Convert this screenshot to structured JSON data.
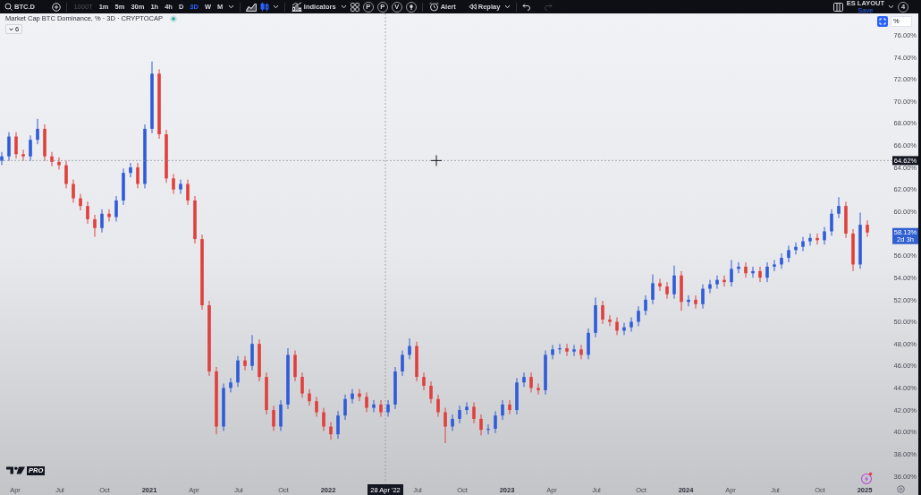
{
  "toolbar": {
    "symbol": "BTC.D",
    "intervals": [
      {
        "label": "1000T",
        "selected": false,
        "disabled": true
      },
      {
        "label": "1m",
        "selected": false,
        "disabled": false
      },
      {
        "label": "5m",
        "selected": false,
        "disabled": false
      },
      {
        "label": "30m",
        "selected": false,
        "disabled": false
      },
      {
        "label": "1h",
        "selected": false,
        "disabled": false
      },
      {
        "label": "4h",
        "selected": false,
        "disabled": false
      },
      {
        "label": "D",
        "selected": false,
        "disabled": false
      },
      {
        "label": "3D",
        "selected": true,
        "disabled": false
      },
      {
        "label": "W",
        "selected": false,
        "disabled": false
      },
      {
        "label": "M",
        "selected": false,
        "disabled": false
      }
    ],
    "chart_types": [
      {
        "kind": "area",
        "selected": false
      },
      {
        "kind": "candles",
        "selected": true
      }
    ],
    "indicators": "Indicators",
    "quick_buttons": [
      {
        "kind": "letter",
        "label": "P"
      },
      {
        "kind": "letter",
        "label": "P"
      },
      {
        "kind": "letter",
        "label": "V"
      },
      {
        "kind": "bulb"
      }
    ],
    "alert": "Alert",
    "replay": "Replay",
    "undo": {
      "disabled": false
    },
    "redo": {
      "disabled": true
    },
    "layout": {
      "name": "ES LAYOUT",
      "action": "Save"
    },
    "notifications": "4"
  },
  "chart": {
    "legend": {
      "title": "Market Cap BTC Dominance, % · 3D · CRYPTOCAP",
      "indicator_count": "6"
    },
    "scale_controls": {
      "auto_scale": {
        "on": true
      },
      "mode": "%"
    },
    "logo": {
      "badge": "PRO"
    },
    "last_price": {
      "price": "58.13%",
      "countdown": "2d 3h"
    },
    "chart_data": {
      "type": "candlestick",
      "x": [
        2020.175,
        2020.215,
        2020.255,
        2020.295,
        2020.335,
        2020.375,
        2020.415,
        2020.455,
        2020.495,
        2020.535,
        2020.575,
        2020.615,
        2020.655,
        2020.695,
        2020.735,
        2020.775,
        2020.815,
        2020.855,
        2020.895,
        2020.935,
        2020.975,
        2021.015,
        2021.055,
        2021.095,
        2021.135,
        2021.175,
        2021.215,
        2021.255,
        2021.295,
        2021.335,
        2021.375,
        2021.415,
        2021.455,
        2021.495,
        2021.535,
        2021.575,
        2021.615,
        2021.655,
        2021.695,
        2021.735,
        2021.775,
        2021.815,
        2021.855,
        2021.895,
        2021.935,
        2021.975,
        2022.015,
        2022.055,
        2022.095,
        2022.135,
        2022.175,
        2022.215,
        2022.255,
        2022.295,
        2022.335,
        2022.375,
        2022.415,
        2022.455,
        2022.495,
        2022.535,
        2022.575,
        2022.615,
        2022.655,
        2022.695,
        2022.735,
        2022.775,
        2022.815,
        2022.855,
        2022.895,
        2022.935,
        2022.975,
        2023.015,
        2023.055,
        2023.095,
        2023.135,
        2023.175,
        2023.215,
        2023.255,
        2023.295,
        2023.335,
        2023.375,
        2023.415,
        2023.455,
        2023.495,
        2023.535,
        2023.575,
        2023.615,
        2023.655,
        2023.695,
        2023.735,
        2023.775,
        2023.815,
        2023.855,
        2023.895,
        2023.935,
        2023.975,
        2024.015,
        2024.055,
        2024.095,
        2024.135,
        2024.175,
        2024.215,
        2024.255,
        2024.295,
        2024.335,
        2024.375,
        2024.415,
        2024.455,
        2024.495,
        2024.535,
        2024.575,
        2024.615,
        2024.655,
        2024.695,
        2024.735,
        2024.775,
        2024.815,
        2024.855,
        2024.895,
        2024.935,
        2024.975,
        2025.015
      ],
      "ohlc": [
        [
          64.6,
          65.4,
          64.2,
          65.0
        ],
        [
          65.0,
          67.2,
          64.6,
          66.8
        ],
        [
          66.8,
          67.2,
          64.8,
          65.2
        ],
        [
          65.2,
          65.6,
          64.6,
          65.0
        ],
        [
          65.0,
          66.9,
          64.6,
          66.5
        ],
        [
          66.5,
          68.4,
          66.1,
          67.5
        ],
        [
          67.5,
          67.9,
          64.6,
          65.0
        ],
        [
          65.0,
          65.4,
          64.1,
          64.5
        ],
        [
          64.5,
          64.9,
          63.8,
          64.2
        ],
        [
          64.2,
          64.6,
          62.1,
          62.5
        ],
        [
          62.5,
          62.9,
          60.8,
          61.2
        ],
        [
          61.2,
          61.6,
          60.1,
          60.5
        ],
        [
          60.5,
          60.9,
          58.9,
          59.3
        ],
        [
          59.3,
          59.7,
          57.7,
          58.5
        ],
        [
          58.5,
          60.2,
          58.1,
          59.8
        ],
        [
          59.8,
          60.2,
          59.1,
          59.5
        ],
        [
          59.5,
          61.4,
          59.1,
          61.0
        ],
        [
          61.0,
          63.9,
          60.6,
          63.5
        ],
        [
          63.5,
          64.4,
          63.1,
          64.0
        ],
        [
          64.0,
          64.4,
          62.1,
          62.5
        ],
        [
          62.5,
          67.9,
          62.1,
          67.5
        ],
        [
          67.5,
          73.6,
          67.1,
          72.5
        ],
        [
          72.5,
          72.9,
          66.6,
          67.0
        ],
        [
          67.0,
          67.4,
          62.6,
          63.0
        ],
        [
          63.0,
          63.4,
          61.6,
          62.0
        ],
        [
          62.0,
          62.9,
          61.6,
          62.5
        ],
        [
          62.5,
          62.9,
          60.6,
          61.0
        ],
        [
          61.0,
          61.4,
          57.1,
          57.5
        ],
        [
          57.5,
          57.9,
          51.1,
          51.5
        ],
        [
          51.5,
          51.9,
          45.1,
          45.5
        ],
        [
          45.5,
          45.9,
          39.8,
          40.5
        ],
        [
          40.5,
          44.4,
          40.1,
          44.0
        ],
        [
          44.0,
          44.9,
          43.6,
          44.5
        ],
        [
          44.5,
          46.9,
          44.1,
          46.5
        ],
        [
          46.5,
          46.9,
          45.6,
          46.0
        ],
        [
          46.0,
          48.8,
          45.6,
          48.0
        ],
        [
          48.0,
          48.4,
          44.6,
          45.0
        ],
        [
          45.0,
          45.4,
          41.6,
          42.0
        ],
        [
          42.0,
          42.4,
          40.1,
          40.5
        ],
        [
          40.5,
          42.9,
          40.1,
          42.5
        ],
        [
          42.5,
          47.6,
          42.1,
          47.0
        ],
        [
          47.0,
          47.4,
          44.6,
          45.0
        ],
        [
          45.0,
          45.4,
          43.1,
          43.5
        ],
        [
          43.5,
          43.9,
          42.4,
          42.8
        ],
        [
          42.8,
          43.2,
          41.4,
          41.8
        ],
        [
          41.8,
          42.2,
          40.1,
          40.5
        ],
        [
          40.5,
          40.9,
          39.3,
          39.8
        ],
        [
          39.8,
          41.9,
          39.4,
          41.5
        ],
        [
          41.5,
          43.4,
          41.1,
          43.0
        ],
        [
          43.0,
          43.9,
          42.6,
          43.5
        ],
        [
          43.5,
          43.9,
          42.8,
          43.2
        ],
        [
          43.2,
          43.6,
          41.8,
          42.2
        ],
        [
          42.2,
          42.9,
          41.8,
          42.5
        ],
        [
          42.5,
          42.9,
          41.4,
          41.8
        ],
        [
          41.8,
          42.9,
          41.4,
          42.5
        ],
        [
          42.5,
          45.9,
          42.1,
          45.5
        ],
        [
          45.5,
          47.4,
          45.1,
          47.0
        ],
        [
          47.0,
          48.5,
          46.6,
          47.8
        ],
        [
          47.8,
          48.2,
          44.6,
          45.0
        ],
        [
          45.0,
          45.4,
          43.8,
          44.2
        ],
        [
          44.2,
          44.6,
          42.6,
          43.0
        ],
        [
          43.0,
          43.4,
          41.4,
          41.8
        ],
        [
          41.8,
          42.2,
          39.0,
          40.5
        ],
        [
          40.5,
          41.6,
          40.1,
          41.2
        ],
        [
          41.2,
          42.4,
          40.8,
          42.0
        ],
        [
          42.0,
          42.7,
          41.6,
          42.3
        ],
        [
          42.3,
          42.7,
          40.8,
          41.2
        ],
        [
          41.2,
          41.6,
          39.7,
          40.2
        ],
        [
          40.2,
          40.7,
          39.8,
          40.3
        ],
        [
          40.3,
          41.9,
          39.9,
          41.5
        ],
        [
          41.5,
          42.9,
          41.1,
          42.5
        ],
        [
          42.5,
          42.9,
          41.6,
          42.0
        ],
        [
          42.0,
          44.9,
          41.6,
          44.5
        ],
        [
          44.5,
          45.4,
          44.1,
          45.0
        ],
        [
          45.0,
          45.4,
          43.6,
          44.0
        ],
        [
          44.0,
          44.4,
          43.4,
          43.8
        ],
        [
          43.8,
          47.4,
          43.4,
          47.0
        ],
        [
          47.0,
          47.9,
          46.6,
          47.5
        ],
        [
          47.5,
          48.0,
          47.1,
          47.6
        ],
        [
          47.6,
          48.0,
          46.9,
          47.3
        ],
        [
          47.3,
          47.9,
          46.9,
          47.5
        ],
        [
          47.5,
          47.9,
          46.6,
          47.0
        ],
        [
          47.0,
          49.4,
          46.6,
          49.0
        ],
        [
          49.0,
          52.2,
          48.6,
          51.5
        ],
        [
          51.5,
          51.9,
          49.8,
          50.2
        ],
        [
          50.2,
          50.6,
          49.6,
          50.0
        ],
        [
          50.0,
          50.4,
          48.8,
          49.2
        ],
        [
          49.2,
          49.9,
          48.8,
          49.5
        ],
        [
          49.5,
          50.4,
          49.1,
          50.0
        ],
        [
          50.0,
          51.4,
          49.6,
          51.0
        ],
        [
          51.0,
          52.4,
          50.6,
          52.0
        ],
        [
          52.0,
          54.3,
          51.6,
          53.5
        ],
        [
          53.5,
          53.9,
          52.8,
          53.2
        ],
        [
          53.2,
          53.6,
          52.1,
          52.5
        ],
        [
          52.5,
          55.1,
          52.1,
          54.2
        ],
        [
          54.2,
          54.6,
          51.0,
          51.8
        ],
        [
          51.8,
          52.4,
          51.4,
          52.0
        ],
        [
          52.0,
          52.4,
          51.2,
          51.6
        ],
        [
          51.6,
          53.4,
          51.2,
          53.0
        ],
        [
          53.0,
          53.8,
          52.6,
          53.4
        ],
        [
          53.4,
          54.2,
          53.0,
          53.8
        ],
        [
          53.8,
          54.2,
          53.2,
          53.6
        ],
        [
          53.6,
          55.6,
          53.2,
          54.8
        ],
        [
          54.8,
          55.4,
          54.4,
          55.0
        ],
        [
          55.0,
          55.4,
          54.0,
          54.4
        ],
        [
          54.4,
          55.0,
          54.0,
          54.6
        ],
        [
          54.6,
          55.0,
          53.6,
          54.0
        ],
        [
          54.0,
          55.4,
          53.6,
          55.0
        ],
        [
          55.0,
          55.6,
          54.6,
          55.2
        ],
        [
          55.2,
          56.2,
          54.8,
          55.8
        ],
        [
          55.8,
          56.9,
          55.4,
          56.5
        ],
        [
          56.5,
          57.2,
          56.1,
          56.8
        ],
        [
          56.8,
          57.7,
          56.4,
          57.3
        ],
        [
          57.3,
          58.0,
          56.9,
          57.6
        ],
        [
          57.6,
          58.0,
          57.0,
          57.4
        ],
        [
          57.4,
          58.6,
          57.0,
          58.2
        ],
        [
          58.2,
          60.2,
          57.8,
          59.8
        ],
        [
          59.8,
          61.3,
          59.4,
          60.5
        ],
        [
          60.5,
          60.9,
          57.6,
          58.0
        ],
        [
          58.0,
          58.4,
          54.6,
          55.2
        ],
        [
          55.2,
          59.9,
          54.8,
          58.8
        ],
        [
          58.8,
          59.2,
          57.7,
          58.1
        ]
      ],
      "xlim": [
        2020.165,
        2025.155
      ],
      "ylim": [
        35.35,
        77.8
      ],
      "xticks": [
        {
          "value": 2020.25,
          "label": "Apr"
        },
        {
          "value": 2020.5,
          "label": "Jul"
        },
        {
          "value": 2020.75,
          "label": "Oct"
        },
        {
          "value": 2021,
          "label": "2021"
        },
        {
          "value": 2021.25,
          "label": "Apr"
        },
        {
          "value": 2021.5,
          "label": "Jul"
        },
        {
          "value": 2021.75,
          "label": "Oct"
        },
        {
          "value": 2022,
          "label": "2022"
        },
        {
          "value": 2022.5,
          "label": "Jul"
        },
        {
          "value": 2022.75,
          "label": "Oct"
        },
        {
          "value": 2023,
          "label": "2023"
        },
        {
          "value": 2023.25,
          "label": "Apr"
        },
        {
          "value": 2023.5,
          "label": "Jul"
        },
        {
          "value": 2023.75,
          "label": "Oct"
        },
        {
          "value": 2024,
          "label": "2024"
        },
        {
          "value": 2024.25,
          "label": "Apr"
        },
        {
          "value": 2024.5,
          "label": "Jul"
        },
        {
          "value": 2024.75,
          "label": "Oct"
        },
        {
          "value": 2025,
          "label": "2025"
        }
      ],
      "yticks": [
        {
          "value": 76,
          "label": "76.00%"
        },
        {
          "value": 74,
          "label": "74.00%"
        },
        {
          "value": 72,
          "label": "72.00%"
        },
        {
          "value": 70,
          "label": "70.00%"
        },
        {
          "value": 68,
          "label": "68.00%"
        },
        {
          "value": 66,
          "label": "66.00%"
        },
        {
          "value": 64,
          "label": "64.00%"
        },
        {
          "value": 62,
          "label": "62.00%"
        },
        {
          "value": 60,
          "label": "60.00%"
        },
        {
          "value": 56,
          "label": "56.00%"
        },
        {
          "value": 54,
          "label": "54.00%"
        },
        {
          "value": 52,
          "label": "52.00%"
        },
        {
          "value": 50,
          "label": "50.00%"
        },
        {
          "value": 48,
          "label": "48.00%"
        },
        {
          "value": 46,
          "label": "46.00%"
        },
        {
          "value": 44,
          "label": "44.00%"
        },
        {
          "value": 42,
          "label": "42.00%"
        },
        {
          "value": 40,
          "label": "40.00%"
        },
        {
          "value": 38,
          "label": "38.00%"
        },
        {
          "value": 36,
          "label": "36.00%"
        }
      ],
      "ref_lines": [
        {
          "axis": "x",
          "value": 2022.32,
          "label": "28 Apr '22"
        },
        {
          "axis": "y",
          "value": 64.62,
          "label": "64.62%"
        }
      ]
    }
  }
}
